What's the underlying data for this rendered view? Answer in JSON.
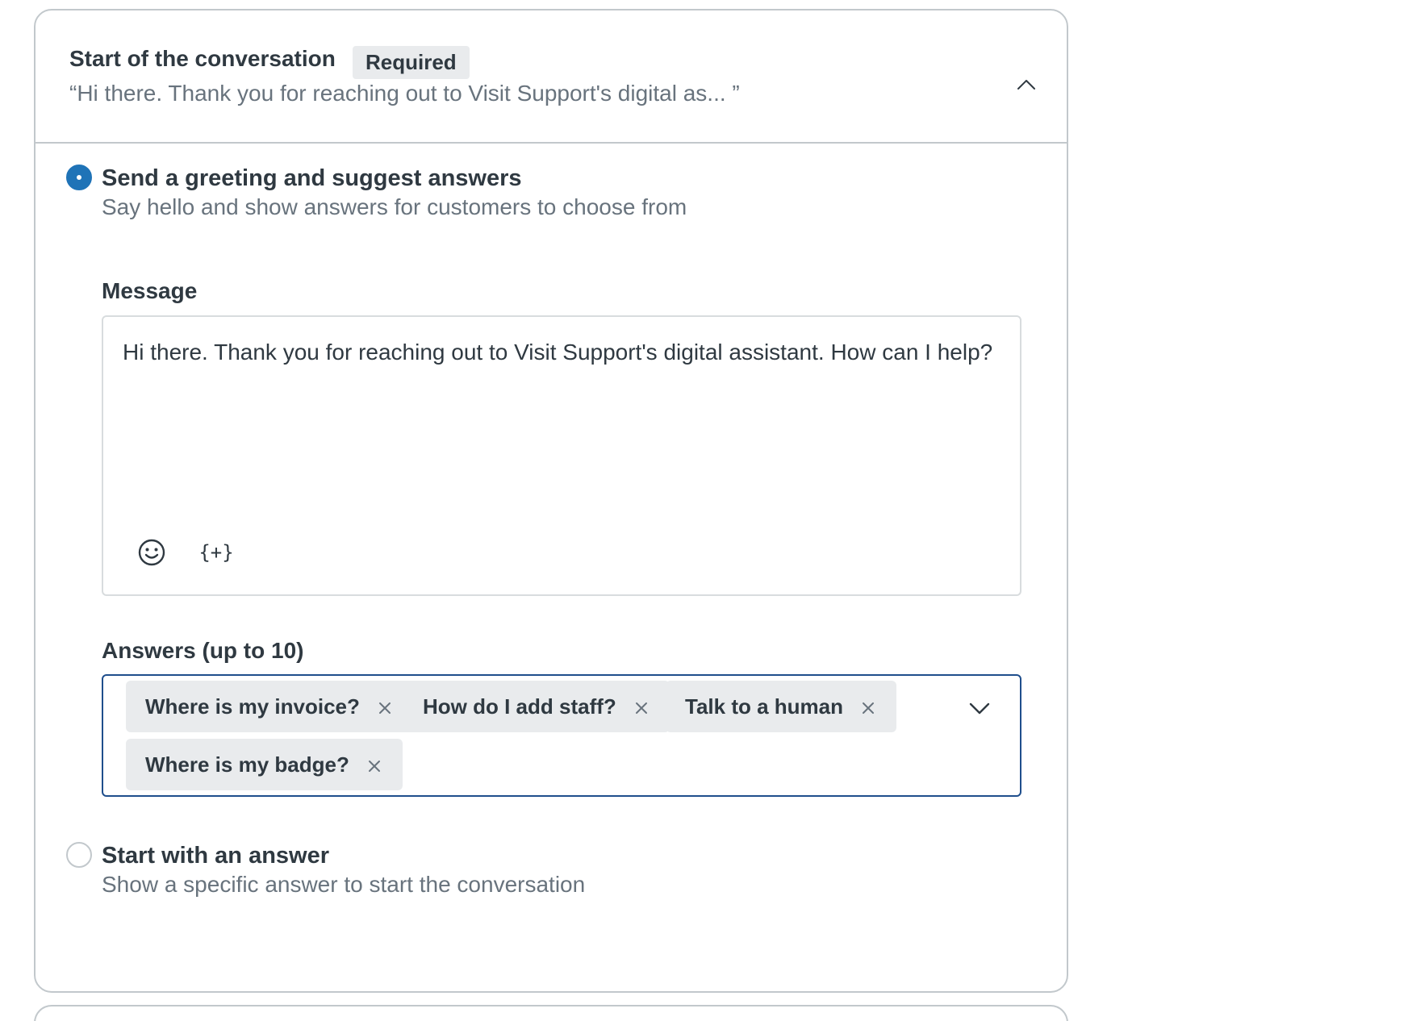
{
  "section": {
    "title": "Start of the conversation",
    "required_badge": "Required",
    "preview": "“Hi there. Thank you for reaching out to Visit Support's digital as...  ”",
    "expanded": true
  },
  "options": [
    {
      "title": "Send a greeting and suggest answers",
      "description": "Say hello and show answers for customers to choose from",
      "selected": true
    },
    {
      "title": "Start with an answer",
      "description": "Show a specific answer to start the conversation",
      "selected": false
    }
  ],
  "message": {
    "label": "Message",
    "value": "Hi there. Thank you for reaching out to Visit Support's digital assistant. How can I help?",
    "toolbar": {
      "emoji_icon": "emoji-icon",
      "variable_label": "{+}"
    }
  },
  "answers": {
    "label": "Answers (up to 10)",
    "tags": [
      "Where is my invoice?",
      "How do I add staff?",
      "Talk to a human",
      "Where is my badge?"
    ]
  },
  "colors": {
    "accent": "#1f73b7",
    "focus_border": "#1f4e8c",
    "tag_bg": "#e9ebed",
    "border": "#c2c8cc",
    "text": "#2f3941",
    "muted_text": "#68737d"
  }
}
